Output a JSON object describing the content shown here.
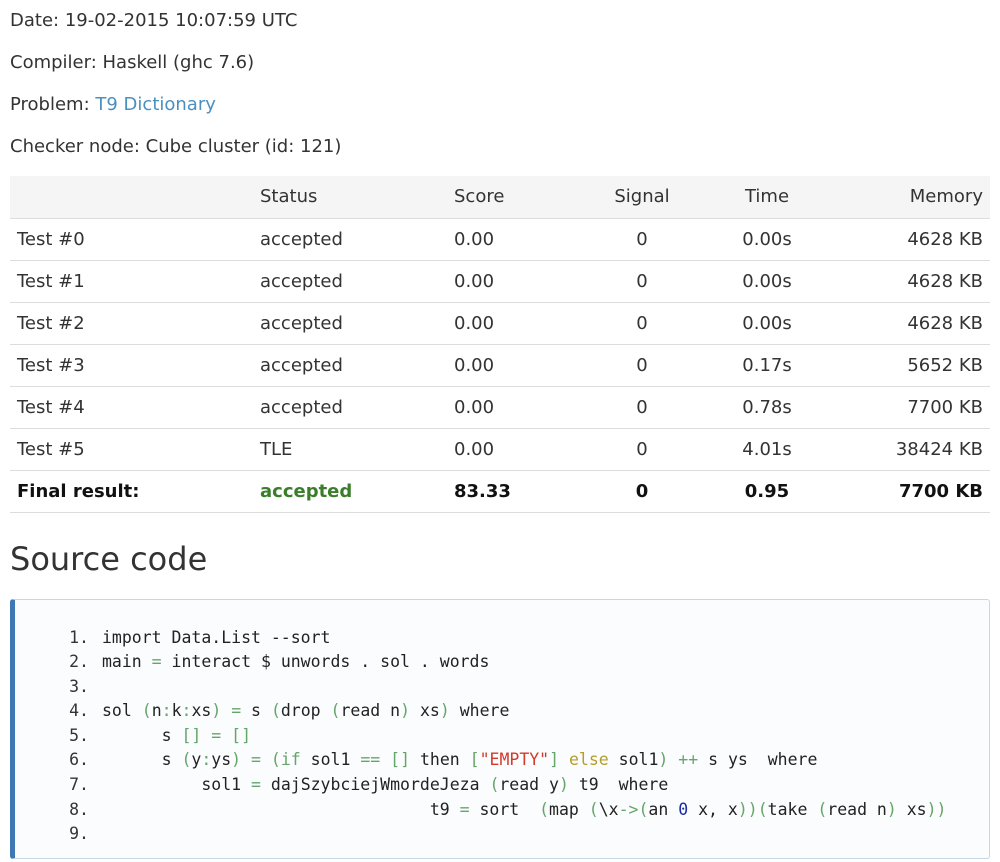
{
  "meta": {
    "date_label": "Date: ",
    "date_value": "19-02-2015 10:07:59 UTC",
    "compiler_label": "Compiler: ",
    "compiler_value": "Haskell (ghc 7.6)",
    "problem_label": "Problem: ",
    "problem_value": "T9 Dictionary",
    "checker_label": "Checker node: ",
    "checker_value": "Cube cluster (id: 121)"
  },
  "table": {
    "headers": [
      "",
      "Status",
      "Score",
      "Signal",
      "Time",
      "Memory"
    ],
    "rows": [
      [
        "Test #0",
        "accepted",
        "0.00",
        "0",
        "0.00s",
        "4628 KB"
      ],
      [
        "Test #1",
        "accepted",
        "0.00",
        "0",
        "0.00s",
        "4628 KB"
      ],
      [
        "Test #2",
        "accepted",
        "0.00",
        "0",
        "0.00s",
        "4628 KB"
      ],
      [
        "Test #3",
        "accepted",
        "0.00",
        "0",
        "0.17s",
        "5652 KB"
      ],
      [
        "Test #4",
        "accepted",
        "0.00",
        "0",
        "0.78s",
        "7700 KB"
      ],
      [
        "Test #5",
        "TLE",
        "0.00",
        "0",
        "4.01s",
        "38424 KB"
      ]
    ],
    "final": [
      "Final result:",
      "accepted",
      "83.33",
      "0",
      "0.95",
      "7700 KB"
    ]
  },
  "source_title": "Source code",
  "code": {
    "numbers": [
      "1.",
      "2.",
      "3.",
      "4.",
      "5.",
      "6.",
      "7.",
      "8.",
      "9."
    ],
    "l1": [
      "import Data.List --sort"
    ],
    "l2": [
      "main ",
      "=",
      " interact $ unwords . sol . words"
    ],
    "l3": [],
    "l4": [
      "sol ",
      "(",
      "n",
      ":",
      "k",
      ":",
      "xs",
      ")",
      " ",
      "=",
      " s ",
      "(",
      "drop ",
      "(",
      "read n",
      ")",
      " xs",
      ")",
      " where"
    ],
    "l5": [
      "      s ",
      "[]",
      " ",
      "=",
      " ",
      "[]"
    ],
    "l6": [
      "      s ",
      "(",
      "y",
      ":",
      "ys",
      ")",
      " ",
      "=",
      " ",
      "(",
      "if",
      " sol1 ",
      "==",
      " ",
      "[]",
      " then ",
      "[",
      "\"EMPTY\"",
      "]",
      " ",
      "else",
      " sol1",
      ")",
      " ",
      "++",
      " s ys  where"
    ],
    "l7": [
      "          sol1 ",
      "=",
      " dajSzybciejWmordeJeza ",
      "(",
      "read y",
      ")",
      " t9  where"
    ],
    "l8": [
      "                                 t9 ",
      "=",
      " sort  ",
      "(",
      "map ",
      "(",
      "\\x",
      "->",
      "(",
      "an ",
      "0",
      " x, x",
      "))(",
      "take ",
      "(",
      "read n",
      ")",
      " xs",
      "))"
    ],
    "l9": []
  },
  "colors": {
    "link": "#4a8fc0",
    "accepted_final": "#3a7d2a",
    "code_border_accent": "#3d77b4",
    "code_operator": "#66a56a",
    "code_string": "#d23a2a",
    "code_else": "#b59d2a",
    "code_number": "#1a2aa0"
  }
}
